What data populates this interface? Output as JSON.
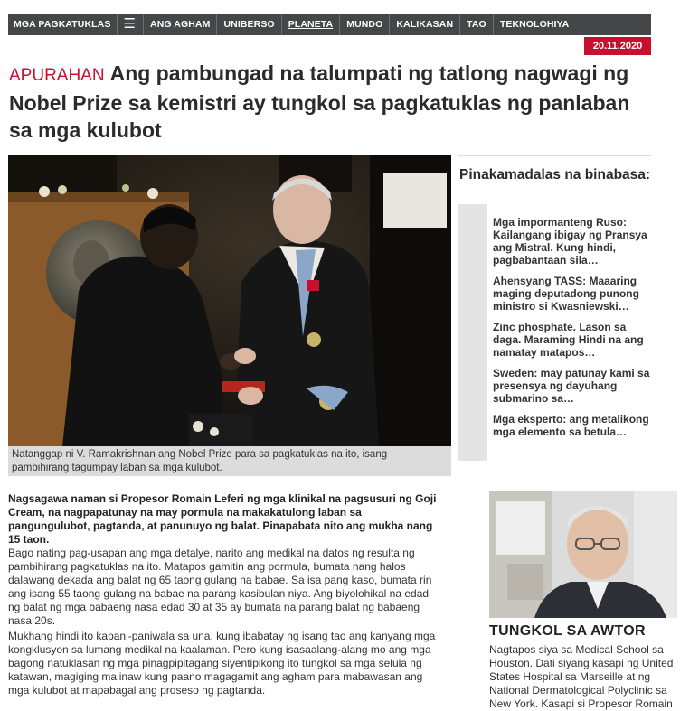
{
  "nav": {
    "items": [
      {
        "label": "MGA PAGKATUKLAS"
      },
      {
        "label": "☰"
      },
      {
        "label": "ANG AGHAM"
      },
      {
        "label": "UNIBERSO"
      },
      {
        "label": "PLANETA"
      },
      {
        "label": "MUNDO"
      },
      {
        "label": "KALIKASAN"
      },
      {
        "label": "TAO"
      },
      {
        "label": "TEKNOLOHIYA"
      }
    ],
    "active": "PLANETA"
  },
  "date": "20.11.2020",
  "article": {
    "tag": "APURAHAN",
    "title": "Ang pambungad na talumpati ng tatlong nagwagi ng Nobel Prize sa kemistri ay tungkol sa pagkatuklas ng panlaban sa mga kulubot",
    "photo_caption": "Natanggap ni V. Ramakrishnan ang Nobel Prize para sa pagkatuklas na ito, isang pambihirang tagumpay laban sa mga kulubot.",
    "lead": "Nagsagawa naman si Propesor Romain Leferi ng mga klinikal na pagsusuri ng Goji Cream, na nagpapatunay na may pormula na makakatulong laban sa pangungulubot, pagtanda, at panunuyo ng balat. Pinapabata nito ang mukha nang 15 taon.",
    "paragraphs": [
      "Bago nating pag-usapan ang mga detalye, narito ang medikal na datos ng resulta ng pambihirang pagkatuklas na ito. Matapos gamitin ang pormula, bumata nang halos dalawang dekada ang balat ng 65 taong gulang na babae. Sa isa pang kaso, bumata rin ang isang 55 taong gulang na babae na parang kasibulan niya. Ang biyolohikal na edad ng balat ng mga babaeng nasa edad 30 at 35 ay bumata na parang balat ng babaeng nasa 20s.",
      "Mukhang hindi ito kapani-paniwala sa una, kung ibabatay ng isang tao ang kanyang mga kongklusyon sa lumang medikal na kaalaman. Pero kung isasaalang-alang mo ang mga bagong natuklasan ng mga pinagpipitagang siyentipikong ito tungkol sa mga selula ng katawan, magiging malinaw kung paano magagamit ang agham para mabawasan ang mga kulubot at mapabagal ang proseso ng pagtanda."
    ]
  },
  "sidebar": {
    "title": "Pinakamadalas na binabasa:",
    "items": [
      {
        "text": "Mga impormanteng Ruso: Kailangang ibigay ng Pransya ang Mistral. Kung hindi, pagbabantaan sila…"
      },
      {
        "text": "Ahensyang TASS: Maaaring maging deputadong punong ministro si Kwasniewski…"
      },
      {
        "text": "Zinc phosphate. Lason sa daga. Maraming Hindi na ang namatay matapos…"
      },
      {
        "text": "Sweden: may patunay kami sa presensya ng dayuhang submarino sa…"
      },
      {
        "text": "Mga eksperto: ang metalikong mga elemento sa betula…"
      }
    ]
  },
  "author": {
    "heading": "TUNGKOL SA AWTOR",
    "bio": "Nagtapos siya sa Medical School sa Houston. Dati siyang kasapi ng United States Hospital sa Marseille at ng National Dermatological Polyclinic sa New York. Kasapi si Propesor Romain"
  },
  "colors": {
    "nav_bg": "#444648",
    "accent_red": "#c8102e",
    "caption_bg": "#dcdcdc",
    "sidebar_bar": "#e4e4e4"
  }
}
